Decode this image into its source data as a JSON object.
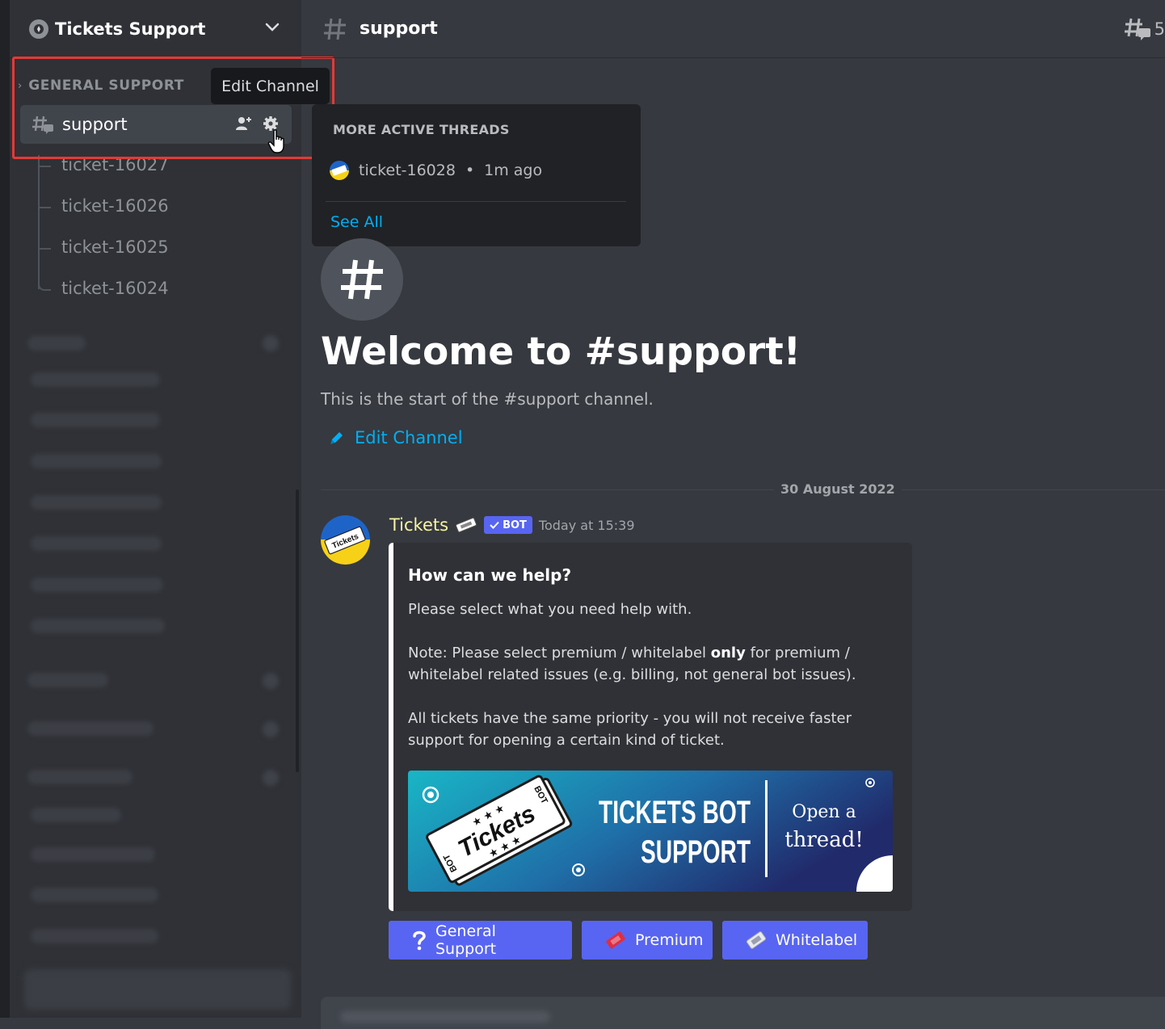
{
  "server": {
    "name": "Tickets Support"
  },
  "sidebar": {
    "category": "GENERAL SUPPORT",
    "active_channel": "support",
    "threads": [
      "ticket-16027",
      "ticket-16026",
      "ticket-16025",
      "ticket-16024"
    ]
  },
  "tooltip": {
    "text": "Edit Channel"
  },
  "topbar": {
    "channel": "support",
    "threads_count": "5"
  },
  "threads_popup": {
    "title": "MORE ACTIVE THREADS",
    "item_name": "ticket-16028",
    "item_separator": "•",
    "item_time": "1m ago",
    "see_all": "See All"
  },
  "welcome": {
    "title": "Welcome to #support!",
    "subtitle": "This is the start of the #support channel.",
    "edit_link": "Edit Channel"
  },
  "date_divider": "30 August 2022",
  "message": {
    "author": "Tickets",
    "bot_tag": "BOT",
    "timestamp": "Today at 15:39",
    "embed": {
      "title": "How can we help?",
      "line1": "Please select what you need help with.",
      "note_prefix": "Note: Please select premium / whitelabel ",
      "note_bold": "only",
      "note_suffix": " for premium / whitelabel related issues (e.g. billing, not general bot issues).",
      "priority": "All tickets have the same priority - you will not receive faster support for opening a certain kind of ticket.",
      "image": {
        "logo_text": "Tickets",
        "bot_text": "BOT",
        "headline_1": "TICKETS BOT",
        "headline_2": "SUPPORT",
        "cta_1": "Open a",
        "cta_2": "thread!"
      }
    },
    "buttons": {
      "general": "General Support",
      "premium": "Premium",
      "whitelabel": "Whitelabel"
    }
  },
  "colors": {
    "accent": "#5865f2",
    "link": "#00aff4",
    "author": "#f8f3a3",
    "highlight": "#e53935",
    "background": "#36393f",
    "sidebar": "#2f3136"
  }
}
